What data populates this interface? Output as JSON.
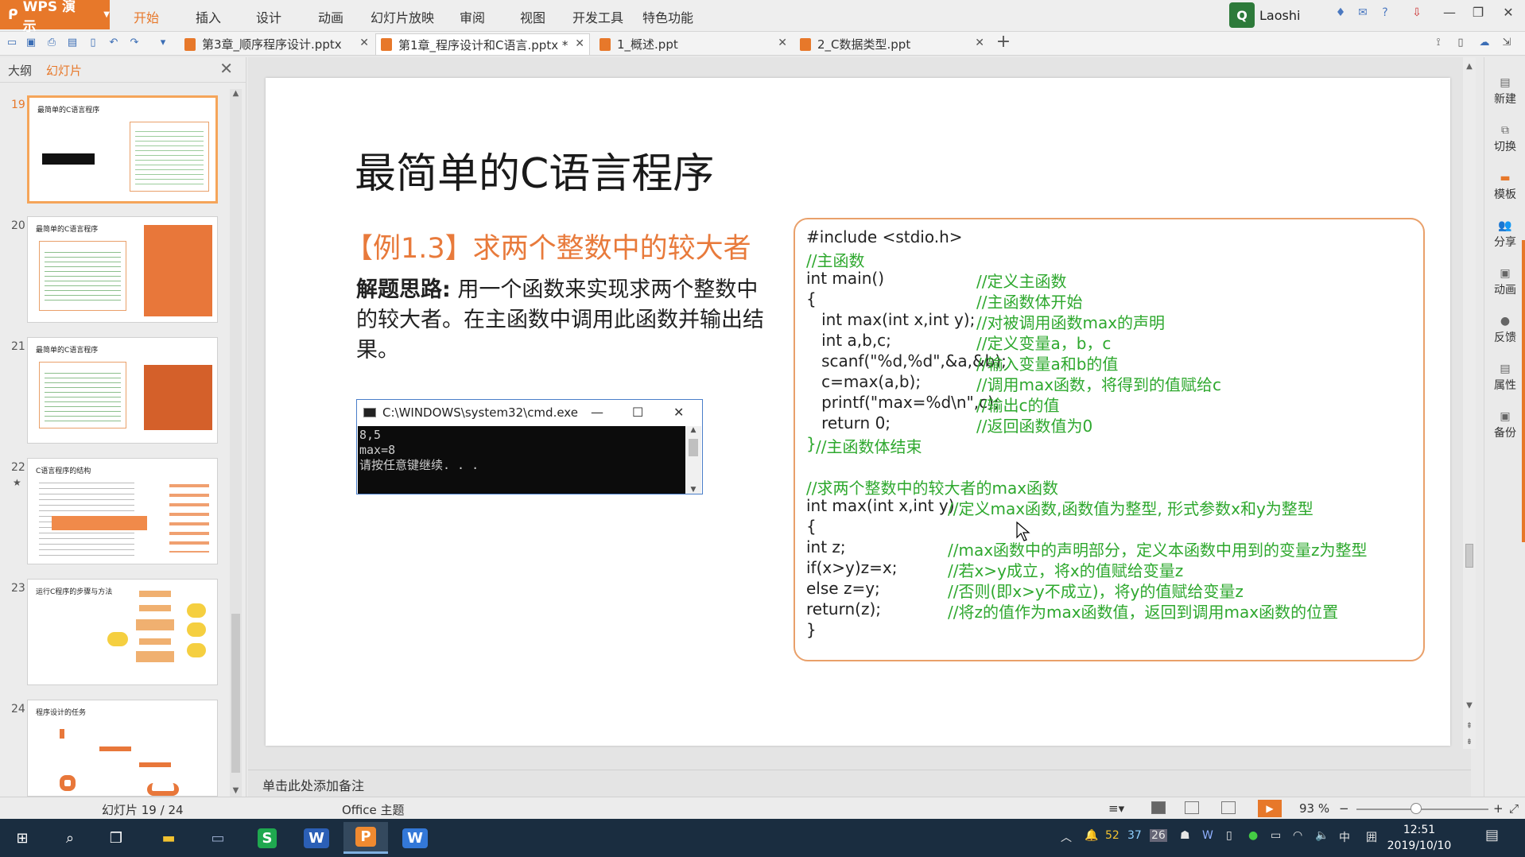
{
  "app": {
    "name": "WPS 演示",
    "menu": [
      "开始",
      "插入",
      "设计",
      "动画",
      "幻灯片放映",
      "审阅",
      "视图",
      "开发工具",
      "特色功能"
    ],
    "active_menu": "开始",
    "user": "Laoshi"
  },
  "tabs": [
    {
      "label": "第3章_顺序程序设计.pptx",
      "active": false
    },
    {
      "label": "第1章_程序设计和C语言.pptx *",
      "active": true
    },
    {
      "label": "1_概述.ppt",
      "active": false
    },
    {
      "label": "2_C数据类型.ppt",
      "active": false
    }
  ],
  "panel": {
    "tab_outline": "大纲",
    "tab_slides": "幻灯片",
    "thumbnails": [
      {
        "num": "19",
        "title": "最简单的C语言程序",
        "active": true
      },
      {
        "num": "20",
        "title": "最简单的C语言程序",
        "active": false
      },
      {
        "num": "21",
        "title": "最简单的C语言程序",
        "active": false
      },
      {
        "num": "22",
        "title": "C语言程序的结构",
        "active": false
      },
      {
        "num": "23",
        "title": "运行C程序的步骤与方法",
        "active": false
      },
      {
        "num": "24",
        "title": "程序设计的任务",
        "active": false
      }
    ]
  },
  "slide": {
    "title": "最简单的C语言程序",
    "example_title": "【例1.3】求两个整数中的较大者",
    "explain_label": "解题思路:",
    "explain_text": "用一个函数来实现求两个整数中的较大者。在主函数中调用此函数并输出结果。",
    "cmd": {
      "title": "C:\\WINDOWS\\system32\\cmd.exe",
      "lines": [
        "8,5",
        "max=8",
        "请按任意键继续. . ."
      ]
    },
    "code": [
      {
        "code": "#include <stdio.h>",
        "comment": ""
      },
      {
        "code": "",
        "comment": "//主函数"
      },
      {
        "code": "int main()",
        "comment": "//定义主函数"
      },
      {
        "code": "{",
        "comment": "//主函数体开始"
      },
      {
        "code": "   int max(int x,int y);",
        "comment": "//对被调用函数max的声明"
      },
      {
        "code": "   int a,b,c;",
        "comment": "//定义变量a，b，c"
      },
      {
        "code": "   scanf(\"%d,%d\",&a,&b);",
        "comment": "//输入变量a和b的值"
      },
      {
        "code": "   c=max(a,b);",
        "comment": "//调用max函数，将得到的值赋给c"
      },
      {
        "code": "   printf(\"max=%d\\n\",c);",
        "comment": "//输出c的值"
      },
      {
        "code": "   return 0;",
        "comment": "//返回函数值为0"
      },
      {
        "code": "}",
        "comment": "//主函数体结束"
      },
      {
        "code": "",
        "comment": "//求两个整数中的较大者的max函数"
      },
      {
        "code": "int max(int x,int y)",
        "comment": "//定义max函数,函数值为整型, 形式参数x和y为整型"
      },
      {
        "code": "{",
        "comment": ""
      },
      {
        "code": "int z;",
        "comment": "//max函数中的声明部分，定义本函数中用到的变量z为整型"
      },
      {
        "code": "if(x>y)z=x;",
        "comment": "//若x>y成立，将x的值赋给变量z"
      },
      {
        "code": "else z=y;",
        "comment": "//否则(即x>y不成立)，将y的值赋给变量z"
      },
      {
        "code": "return(z);",
        "comment": "//将z的值作为max函数值，返回到调用max函数的位置"
      },
      {
        "code": "}",
        "comment": ""
      }
    ]
  },
  "notes_placeholder": "单击此处添加备注",
  "rail": [
    "新建",
    "切换",
    "模板",
    "分享",
    "动画",
    "反馈",
    "属性",
    "备份"
  ],
  "status": {
    "slide_info": "幻灯片 19 / 24",
    "theme": "Office 主题",
    "zoom": "93 %"
  },
  "taskbar": {
    "tray": [
      "52",
      "37",
      "26",
      "中"
    ],
    "time": "12:51",
    "date": "2019/10/10"
  },
  "colors": {
    "accent": "#e7782a",
    "comment_green": "#2ea82e",
    "example_orange": "#e87a3b"
  }
}
